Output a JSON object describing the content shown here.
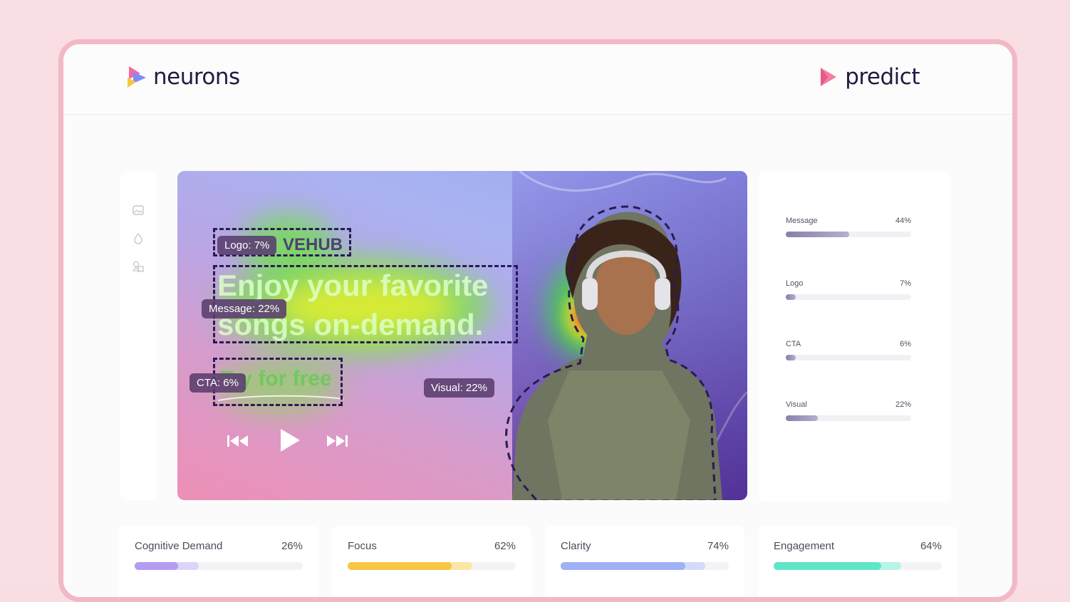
{
  "brand_left": {
    "name": "neurons",
    "icon": "neurons-logo-icon"
  },
  "brand_right": {
    "name": "predict",
    "icon": "predict-logo-icon"
  },
  "side_tools": [
    {
      "icon": "image-icon"
    },
    {
      "icon": "drop-icon"
    },
    {
      "icon": "shapes-icon"
    }
  ],
  "ad": {
    "logo_text": "VEHUB",
    "headline_line1": "Enjoy your favorite",
    "headline_line2": "songs on-demand.",
    "cta_text": "Try for free",
    "controls": [
      "previous-icon",
      "play-icon",
      "next-icon"
    ]
  },
  "aoi_tags": {
    "logo": "Logo: 7%",
    "message": "Message: 22%",
    "cta": "CTA: 6%",
    "visual": "Visual: 22%"
  },
  "stats": [
    {
      "label": "Message",
      "value": "44%",
      "fraction": 0.44
    },
    {
      "label": "Logo",
      "value": "7%",
      "fraction": 0.07
    },
    {
      "label": "CTA",
      "value": "6%",
      "fraction": 0.06
    },
    {
      "label": "Visual",
      "value": "22%",
      "fraction": 0.22
    }
  ],
  "metrics": [
    {
      "label": "Cognitive Demand",
      "value": "26%",
      "fraction": 0.26,
      "color": "#b49cf2",
      "light": "#ddd3fb"
    },
    {
      "label": "Focus",
      "value": "62%",
      "fraction": 0.62,
      "color": "#f6c644",
      "light": "#fbe6a6"
    },
    {
      "label": "Clarity",
      "value": "74%",
      "fraction": 0.74,
      "color": "#9eb1f6",
      "light": "#d2dbfb"
    },
    {
      "label": "Engagement",
      "value": "64%",
      "fraction": 0.64,
      "color": "#5fe6c8",
      "light": "#b6f4e6"
    }
  ]
}
